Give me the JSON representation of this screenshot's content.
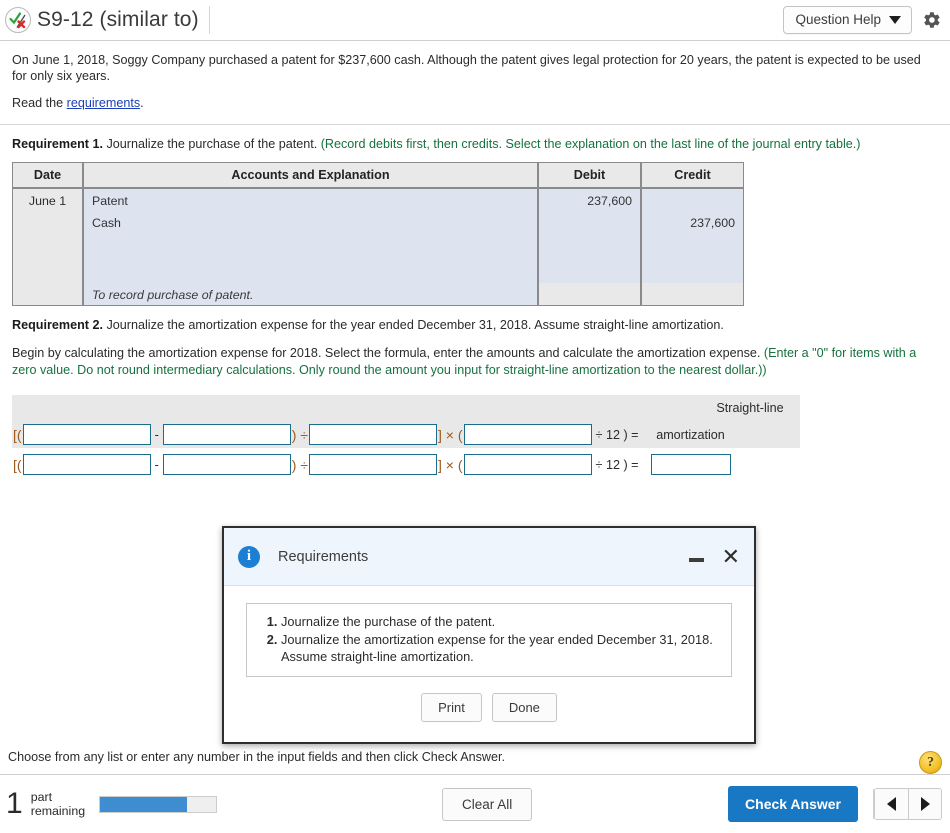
{
  "header": {
    "status_icon": "check-cross-icon",
    "title": "S9-12 (similar to)",
    "question_help_label": "Question Help",
    "gear_icon": "gear-icon"
  },
  "problem": {
    "paragraph": "On June 1, 2018, Soggy Company purchased a patent for $237,600 cash. Although the patent gives legal protection for 20 years, the patent is expected to be used for only six years.",
    "read_prefix": "Read the ",
    "read_link": "requirements",
    "read_suffix": "."
  },
  "requirement1": {
    "label": "Requirement 1.",
    "body": " Journalize the purchase of the patent. ",
    "hint": "(Record debits first, then credits. Select the explanation on the last line of the journal entry table.)",
    "table": {
      "headers": [
        "Date",
        "Accounts and Explanation",
        "Debit",
        "Credit"
      ],
      "rows": [
        {
          "date": "June 1",
          "account": "Patent",
          "indent": false,
          "debit": "237,600",
          "credit": ""
        },
        {
          "date": "",
          "account": "Cash",
          "indent": true,
          "debit": "",
          "credit": "237,600"
        },
        {
          "date": "",
          "account": "",
          "indent": false,
          "debit": "",
          "credit": ""
        },
        {
          "date": "",
          "account": "To record purchase of patent.",
          "indent": false,
          "debit": "",
          "credit": ""
        }
      ]
    }
  },
  "requirement2": {
    "label": "Requirement 2.",
    "body": " Journalize the amortization expense for the year ended December 31, 2018. Assume straight-line amortization.",
    "instruction": "Begin by calculating the amortization expense for 2018. Select the formula, enter the amounts and calculate the amortization expense. ",
    "instruction_hint": "(Enter a \"0\" for items with a zero value. Do not round intermediary calculations. Only round the amount you input for straight-line amortization to the nearest dollar.))",
    "formula": {
      "open_bracket": "[(",
      "minus": "-",
      "close_paren_divide": ") ÷",
      "close_bracket_times": "] × (",
      "divide_twelve": "÷ 12 ) =",
      "result_label_line1": "Straight-line",
      "result_label_line2": "amortization",
      "inputs": [
        "",
        "",
        "",
        "",
        ""
      ],
      "result_value": ""
    }
  },
  "modal": {
    "info_icon": "info-icon",
    "title": "Requirements",
    "minimize_icon": "minimize-icon",
    "close_icon": "close-icon",
    "items": [
      "Journalize the purchase of the patent.",
      "Journalize the amortization expense for the year ended December 31, 2018. Assume straight-line amortization."
    ],
    "print_label": "Print",
    "done_label": "Done"
  },
  "footer": {
    "note": "Choose from any list or enter any number in the input fields and then click Check Answer.",
    "help_icon": "question-mark-icon",
    "parts_remaining_count": "1",
    "parts_remaining_line1": "part",
    "parts_remaining_line2": "remaining",
    "progress_percent": 75,
    "clear_all_label": "Clear All",
    "check_answer_label": "Check Answer",
    "prev_icon": "triangle-left-icon",
    "next_icon": "triangle-right-icon"
  },
  "colors": {
    "accent_blue": "#1878c4",
    "progress_blue": "#3d8dd0",
    "hint_green": "#15713e",
    "link_blue": "#1b3fb5",
    "table_blue": "#dde4f0",
    "table_gray": "#e9e9e9",
    "input_border": "#1b6d8d"
  }
}
